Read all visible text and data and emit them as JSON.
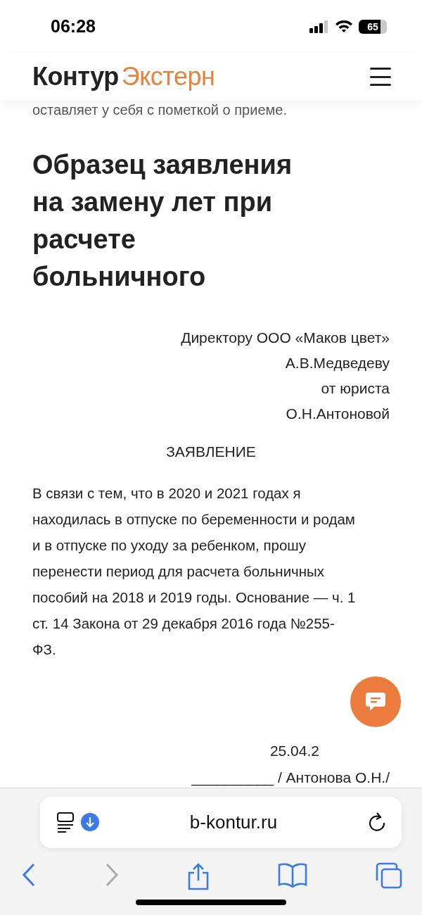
{
  "status_bar": {
    "time": "06:28",
    "battery": "65"
  },
  "header": {
    "logo_dark": "Контур",
    "logo_accent": "Экстерн"
  },
  "article": {
    "previous_line": "оставляет у себя с пометкой о приеме.",
    "title": "Образец заявления на замену лет при расчете больничного",
    "addressee": [
      "Директору ООО «Маков цвет»",
      "А.В.Медведеву",
      "от юриста",
      "О.Н.Антоновой"
    ],
    "doc_title": "ЗАЯВЛЕНИЕ",
    "body": "В связи с тем, что в 2020 и 2021 годах я находилась в отпуске по беременности и родам и в отпуске по уходу за ребенком, прошу перенести период для расчета больничных пособий на 2018 и 2019 годы. Основание — ч. 1 ст. 14 Закона от 29 декабря 2016 года №255-ФЗ.",
    "date": "25.04.2",
    "signature_line": "__________",
    "signature": "/ Антонова О.Н./"
  },
  "browser": {
    "url": "b-kontur.ru",
    "forward_disabled": true
  }
}
